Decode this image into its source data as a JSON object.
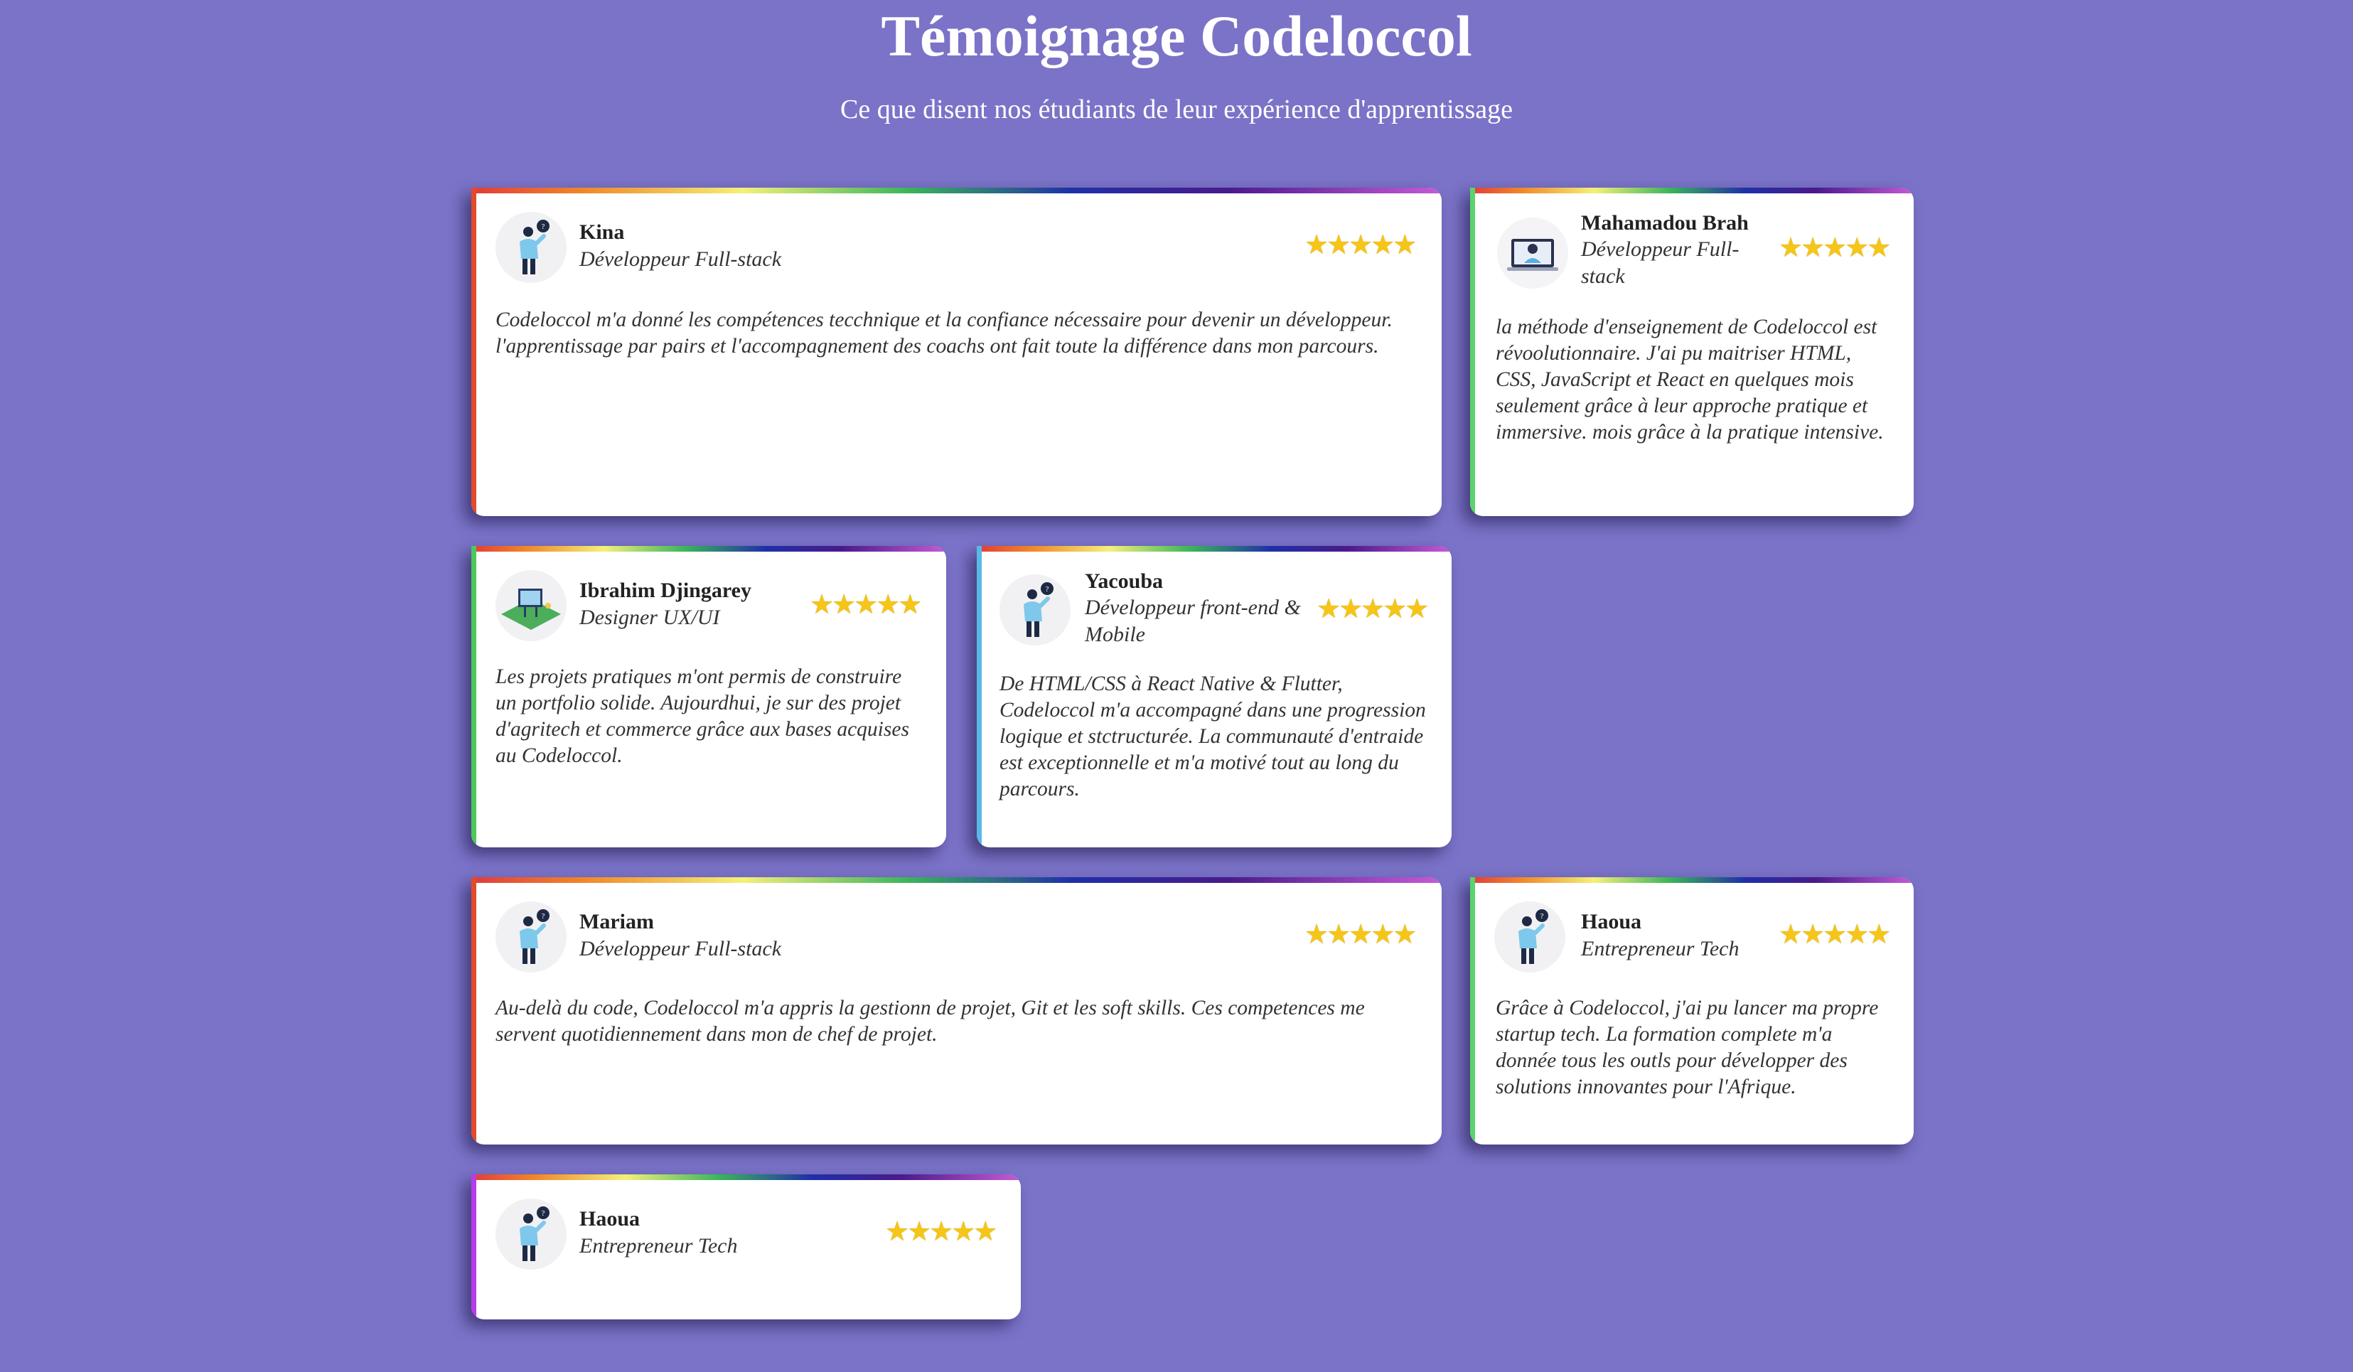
{
  "header": {
    "title": "Témoignage Codeloccol",
    "subtitle": "Ce que disent nos étudiants de leur expérience d'apprentissage"
  },
  "rating_glyphs": "★★★★★",
  "colors": {
    "background": "#7b73c8",
    "card": "#ffffff",
    "star": "#f5c518"
  },
  "testimonials": [
    {
      "name": "Kina",
      "role": "Développeur Full-stack",
      "rating": 5,
      "avatar": "developer-avatar-icon",
      "quote": "Codeloccol m'a donné les compétences tecchnique et la confiance nécessaire pour devenir un développeur. l'apprentissage par pairs et l'accompagnement des coachs ont fait toute la différence dans mon parcours."
    },
    {
      "name": "Mahamadou Brah",
      "role": "Développeur Full-stack",
      "rating": 5,
      "avatar": "laptop-avatar-icon",
      "quote": "la méthode d'enseignement de Codeloccol est révoolutionnaire. J'ai pu maitriser HTML, CSS, JavaScript et React en quelques mois seulement grâce à leur approche pratique et immersive. mois grâce à la pratique intensive."
    },
    {
      "name": "Ibrahim Djingarey",
      "role": "Designer UX/UI",
      "rating": 5,
      "avatar": "design-board-avatar-icon",
      "quote": "Les projets pratiques m'ont permis de construire un portfolio solide. Aujourdhui, je sur des projet d'agritech et commerce grâce aux bases acquises au Codeloccol."
    },
    {
      "name": "Yacouba",
      "role": "Développeur front-end & Mobile",
      "rating": 5,
      "avatar": "developer-avatar-icon",
      "quote": "De HTML/CSS à React Native & Flutter, Codeloccol m'a accompagné dans une progression logique et stctructurée. La communauté d'entraide est exceptionnelle et m'a motivé tout au long du parcours."
    },
    {
      "name": "Mariam",
      "role": "Développeur Full-stack",
      "rating": 5,
      "avatar": "developer-avatar-icon",
      "quote": "Au-delà du code, Codeloccol m'a appris la gestionn de projet, Git et les soft skills. Ces competences me servent quotidiennement dans mon de chef de projet."
    },
    {
      "name": "Haoua",
      "role": "Entrepreneur Tech",
      "rating": 5,
      "avatar": "developer-avatar-icon",
      "quote": "Grâce à Codeloccol, j'ai pu lancer ma propre startup tech. La formation complete m'a donnée tous les outls pour développer des solutions innovantes pour l'Afrique."
    },
    {
      "name": "Haoua",
      "role": "Entrepreneur Tech",
      "rating": 5,
      "avatar": "developer-avatar-icon",
      "quote": ""
    }
  ]
}
